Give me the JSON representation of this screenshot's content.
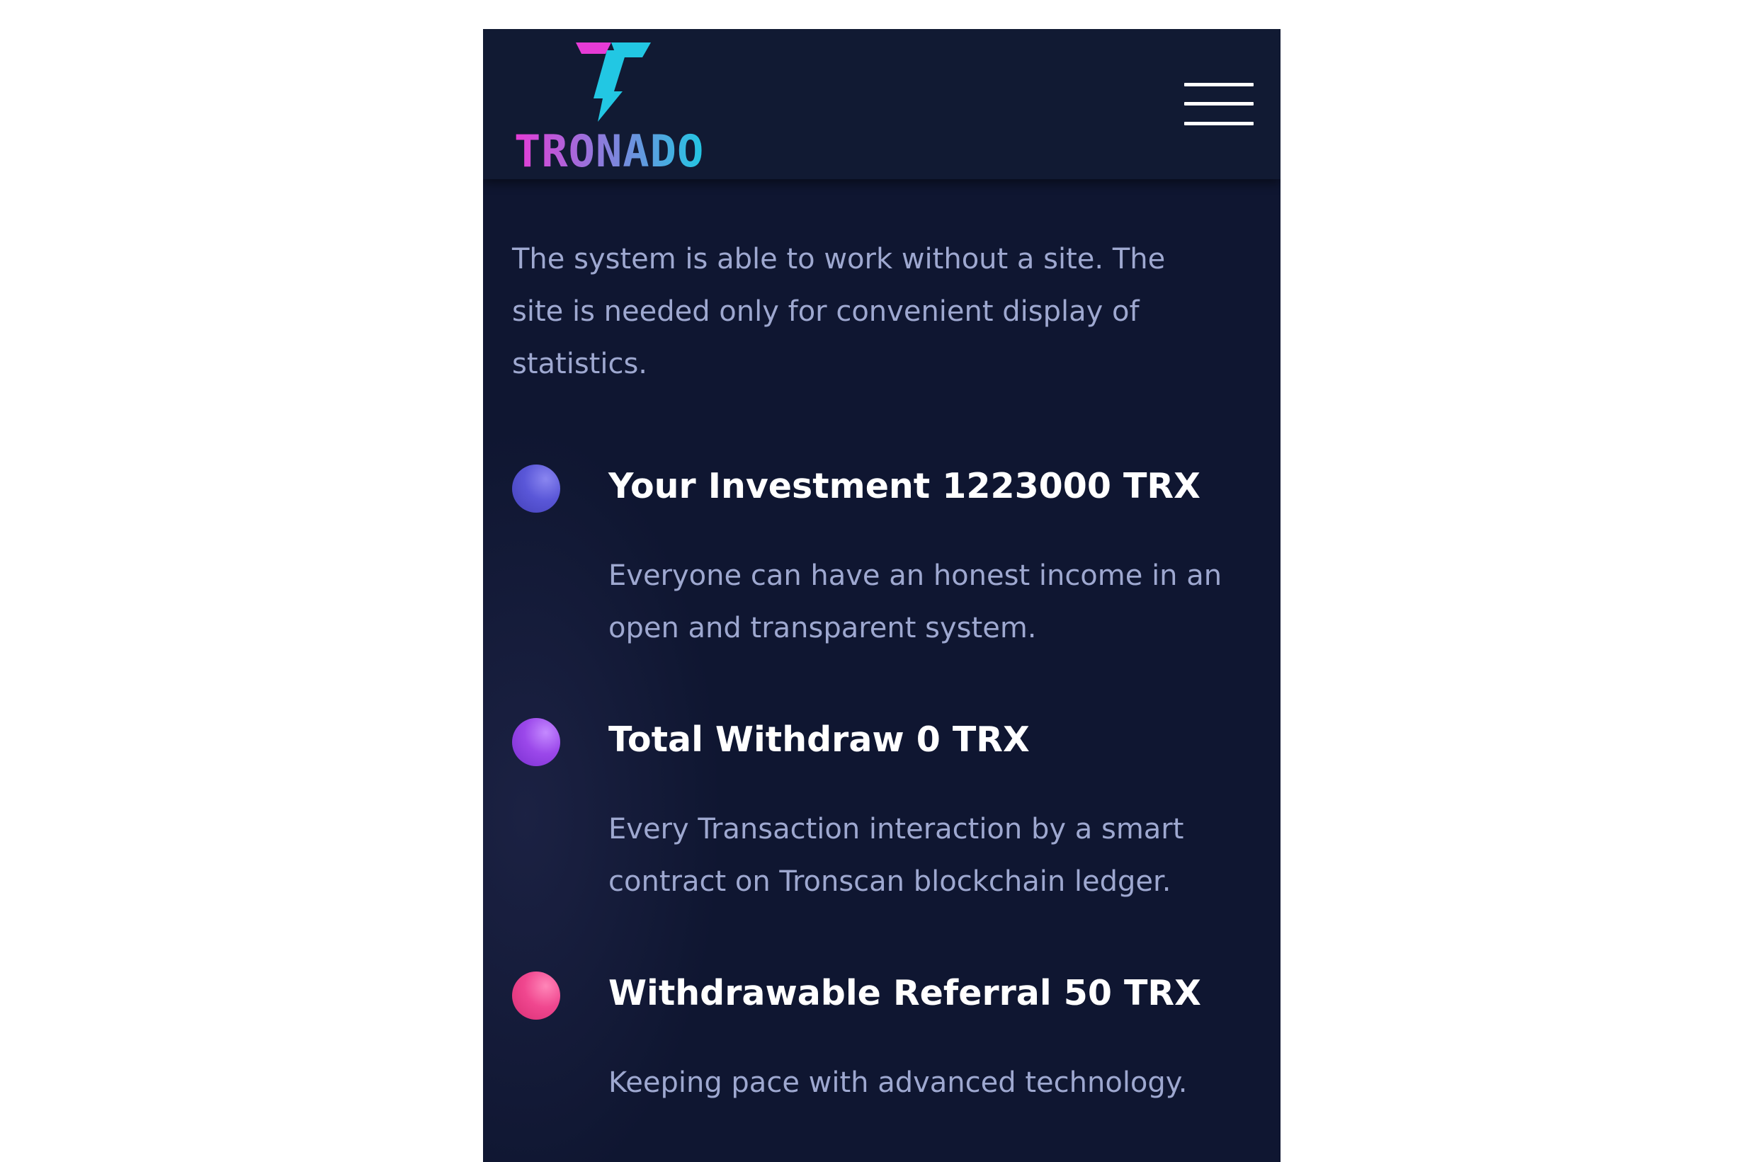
{
  "header": {
    "logo_text": "TRONADO",
    "logo_colors": {
      "magenta": "#e63bd6",
      "cyan": "#22c7e3"
    },
    "menu_icon": "hamburger-menu-icon"
  },
  "intro": {
    "text": "The system is able to work without a site. The site is needed only for convenient display of statistics."
  },
  "stats": [
    {
      "title": "Your Investment 1223000 TRX",
      "description": "Everyone can have an honest income in an open and transparent system.",
      "dot_color": "#5a57d8"
    },
    {
      "title": "Total Withdraw 0 TRX",
      "description": "Every Transaction interaction by a smart contract on Tronscan blockchain ledger.",
      "dot_color": "#9b48ea"
    },
    {
      "title": "Withdrawable Referral 50 TRX",
      "description": "Keeping pace with advanced technology.",
      "dot_color": "#f0478f"
    }
  ],
  "colors": {
    "background": "#0f1631",
    "header_background": "#111a33",
    "body_text": "#9ea8d0",
    "title_text": "#ffffff"
  }
}
